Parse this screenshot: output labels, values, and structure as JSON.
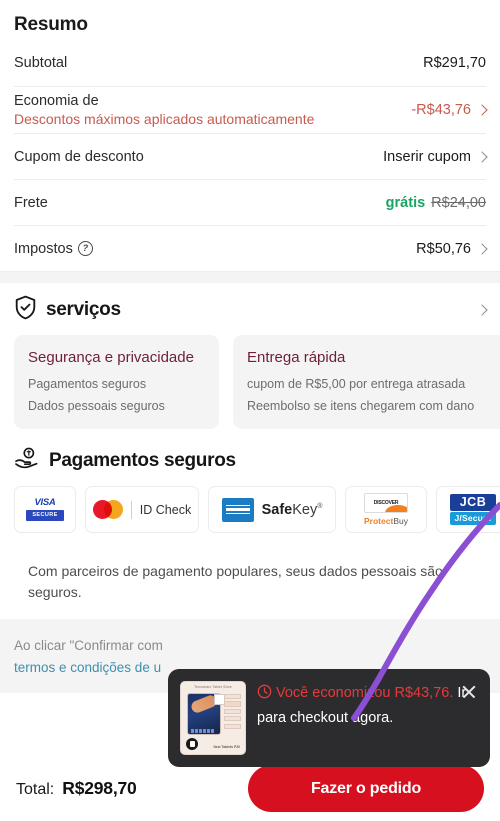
{
  "summary": {
    "title": "Resumo",
    "rows": [
      {
        "label": "Subtotal",
        "sub": "",
        "value": "R$291,70",
        "chevron": false
      },
      {
        "label": "Economia de",
        "sub": "Descontos máximos aplicados automaticamente",
        "value": "-R$43,76",
        "chevron": true
      },
      {
        "label": "Cupom de desconto",
        "sub": "",
        "value": "Inserir cupom",
        "chevron": true
      },
      {
        "label": "Frete",
        "sub": "",
        "value_free": "grátis",
        "value_struck": "R$24,00",
        "chevron": false
      },
      {
        "label": "Impostos",
        "sub": "",
        "value": "R$50,76",
        "chevron": true
      }
    ]
  },
  "services": {
    "title": "serviços",
    "shield_icon": "shield-check-icon",
    "chevron_icon": "chevron-right-icon",
    "cards": [
      {
        "title": "Segurança e privacidade",
        "items": [
          "Pagamentos seguros",
          "Dados pessoais seguros"
        ]
      },
      {
        "title": "Entrega rápida",
        "items": [
          "cupom de R$5,00 por entrega atrasada",
          "Reembolso se itens chegarem com dano"
        ]
      }
    ]
  },
  "payments": {
    "title": "Pagamentos seguros",
    "icon": "hand-coin-icon",
    "badges": [
      {
        "name": "visa-secure-badge",
        "top": "VISA",
        "bottom": "SECURE"
      },
      {
        "name": "mastercard-id-check-badge",
        "text": "ID Check"
      },
      {
        "name": "amex-safekey-badge",
        "text_bold": "Safe",
        "text_light": "Key"
      },
      {
        "name": "discover-protectbuy-badge",
        "mark": "DISCOVER",
        "bold": "Protect",
        "light": "Buy"
      },
      {
        "name": "jcb-jsecure-badge",
        "top": "JCB",
        "bottom": "J/Secure"
      }
    ],
    "note": "Com parceiros de pagamento populares, seus dados pessoais são seguros."
  },
  "terms": {
    "text_before": "Ao clicar \"Confirmar com",
    "link": "termos e condições de u"
  },
  "bottombar": {
    "total_label": "Total:",
    "total_value": "R$298,70",
    "cta_label": "Fazer o pedido"
  },
  "toast": {
    "clock_icon": "clock-icon",
    "close_icon": "close-icon",
    "saved_text": "Você economizou R$43,76.",
    "action_text": " Ir para checkout agora.",
    "thumb_header": "Tecnomarc Tablet Store",
    "thumb_footer": "New Tablets P20"
  },
  "colors": {
    "accent_red": "#c75a4d",
    "cta_red": "#d6101f",
    "green": "#19a463",
    "maroon": "#6e1f35",
    "link_blue": "#3f8fb0",
    "toast_bg": "#2c2c2e",
    "toast_red": "#e23b3b",
    "annotation_purple": "#8a4fd3"
  }
}
